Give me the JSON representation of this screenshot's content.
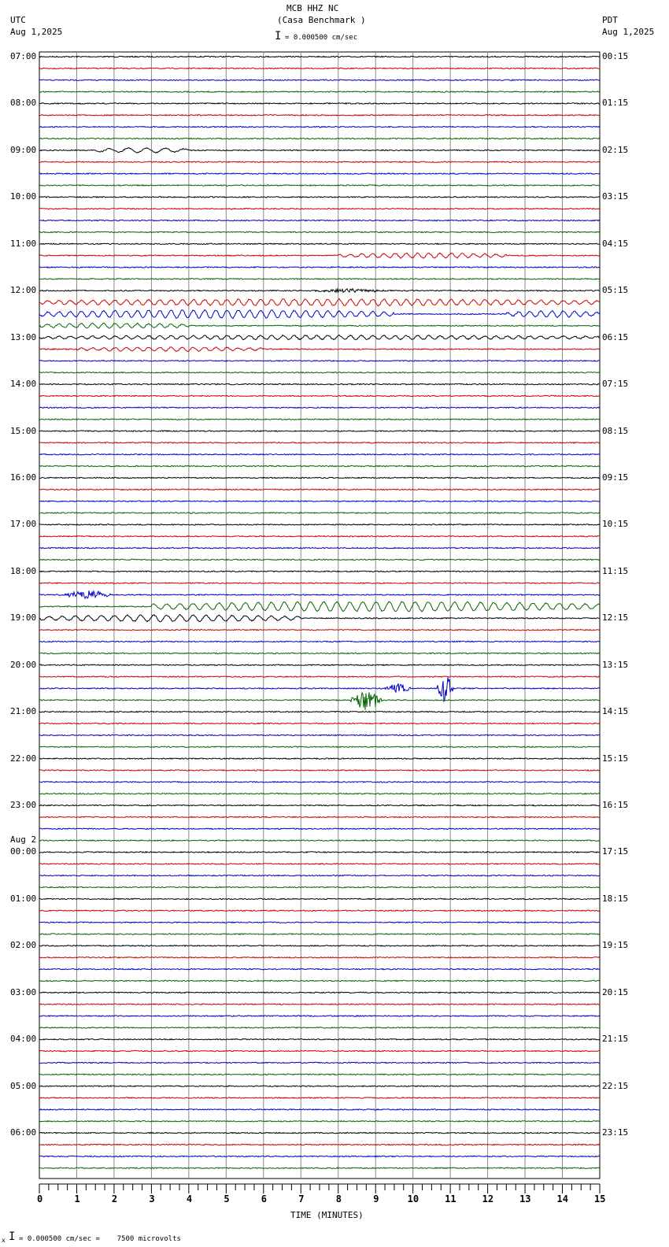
{
  "header": {
    "station": "MCB HHZ NC",
    "site": "(Casa Benchmark )",
    "scale": "= 0.000500 cm/sec",
    "left_tz": "UTC",
    "left_date": "Aug 1,2025",
    "right_tz": "PDT",
    "right_date": "Aug 1,2025"
  },
  "footer": {
    "scale": "= 0.000500 cm/sec =    7500 microvolts",
    "prefix": "x"
  },
  "chart_data": {
    "type": "line",
    "title": "MCB HHZ NC (Casa Benchmark )",
    "xlabel": "TIME (MINUTES)",
    "xlim": [
      0,
      15
    ],
    "x_ticks": [
      "0",
      "1",
      "2",
      "3",
      "4",
      "5",
      "6",
      "7",
      "8",
      "9",
      "10",
      "11",
      "12",
      "13",
      "14",
      "15"
    ],
    "trace_minutes": 15,
    "trace_count": 96,
    "colors": [
      "#000000",
      "#cc0000",
      "#0000cc",
      "#006600"
    ],
    "left_labels": [
      "07:00",
      "08:00",
      "09:00",
      "10:00",
      "11:00",
      "12:00",
      "13:00",
      "14:00",
      "15:00",
      "16:00",
      "17:00",
      "18:00",
      "19:00",
      "20:00",
      "21:00",
      "22:00",
      "23:00",
      "00:00",
      "01:00",
      "02:00",
      "03:00",
      "04:00",
      "05:00",
      "06:00"
    ],
    "date_change_label": "Aug 2",
    "right_labels": [
      "00:15",
      "01:15",
      "02:15",
      "03:15",
      "04:15",
      "05:15",
      "06:15",
      "07:15",
      "08:15",
      "09:15",
      "10:15",
      "11:15",
      "12:15",
      "13:15",
      "14:15",
      "15:15",
      "16:15",
      "17:15",
      "18:15",
      "19:15",
      "20:15",
      "21:15",
      "22:15",
      "23:15"
    ],
    "events": [
      {
        "trace": 8,
        "start": 1.5,
        "end": 4,
        "amp": 3,
        "period": 0.5,
        "kind": "wave"
      },
      {
        "trace": 17,
        "start": 8,
        "end": 12.5,
        "amp": 3,
        "period": 0.3,
        "kind": "wave"
      },
      {
        "trace": 20,
        "start": 7,
        "end": 9.5,
        "amp": 2,
        "period": 0.05,
        "kind": "noise"
      },
      {
        "trace": 21,
        "start": 0,
        "end": 15,
        "amp": 4,
        "period": 0.3,
        "kind": "wave"
      },
      {
        "trace": 22,
        "start": 0,
        "end": 9.5,
        "amp": 5,
        "period": 0.3,
        "kind": "wave"
      },
      {
        "trace": 22,
        "start": 12.5,
        "end": 15,
        "amp": 4,
        "period": 0.3,
        "kind": "wave"
      },
      {
        "trace": 23,
        "start": 0,
        "end": 4,
        "amp": 3,
        "period": 0.3,
        "kind": "wave"
      },
      {
        "trace": 24,
        "start": 0,
        "end": 15,
        "amp": 2.5,
        "period": 0.3,
        "kind": "wave"
      },
      {
        "trace": 25,
        "start": 1,
        "end": 6,
        "amp": 2.5,
        "period": 0.3,
        "kind": "wave"
      },
      {
        "trace": 46,
        "start": 0.6,
        "end": 2,
        "amp": 6,
        "period": 0.05,
        "kind": "noise"
      },
      {
        "trace": 47,
        "start": 3,
        "end": 15,
        "amp": 6,
        "period": 0.35,
        "kind": "wave"
      },
      {
        "trace": 48,
        "start": 0,
        "end": 7,
        "amp": 4,
        "period": 0.35,
        "kind": "wave"
      },
      {
        "trace": 54,
        "start": 9.2,
        "end": 10,
        "amp": 6,
        "period": 0.05,
        "kind": "noise"
      },
      {
        "trace": 54,
        "start": 10.6,
        "end": 11.1,
        "amp": 18,
        "period": 0.03,
        "kind": "noise"
      },
      {
        "trace": 55,
        "start": 8.3,
        "end": 9.2,
        "amp": 12,
        "period": 0.03,
        "kind": "noise"
      }
    ]
  }
}
